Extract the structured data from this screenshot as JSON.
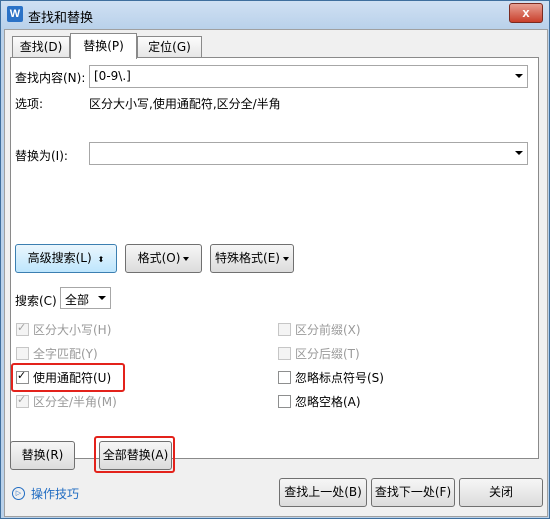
{
  "window": {
    "title": "查找和替换",
    "app_icon": "W",
    "close_glyph": "x"
  },
  "tabs": [
    {
      "label": "查找(D)",
      "active": false
    },
    {
      "label": "替换(P)",
      "active": true
    },
    {
      "label": "定位(G)",
      "active": false
    }
  ],
  "find": {
    "label": "查找内容(N):",
    "value": "[0-9\\.]"
  },
  "options": {
    "label": "选项:",
    "value": "区分大小写,使用通配符,区分全/半角"
  },
  "replace": {
    "label": "替换为(I):",
    "value": ""
  },
  "buttons": {
    "advanced": "高级搜索(L)",
    "advanced_glyph": "⬍",
    "format": "格式(O)",
    "special": "特殊格式(E)"
  },
  "search": {
    "label": "搜索(C)",
    "value": "全部"
  },
  "checkboxes": {
    "match_case": {
      "label": "区分大小写(H)",
      "checked": true,
      "enabled": false
    },
    "whole_word": {
      "label": "全字匹配(Y)",
      "checked": false,
      "enabled": false
    },
    "wildcards": {
      "label": "使用通配符(U)",
      "checked": true,
      "enabled": true
    },
    "width": {
      "label": "区分全/半角(M)",
      "checked": true,
      "enabled": false
    },
    "prefix": {
      "label": "区分前缀(X)",
      "checked": false,
      "enabled": false
    },
    "suffix": {
      "label": "区分后缀(T)",
      "checked": false,
      "enabled": false
    },
    "ignore_punct": {
      "label": "忽略标点符号(S)",
      "checked": false,
      "enabled": true
    },
    "ignore_space": {
      "label": "忽略空格(A)",
      "checked": false,
      "enabled": true
    }
  },
  "check_glyph": "✓",
  "actions": {
    "replace": "替换(R)",
    "replace_all": "全部替换(A)",
    "find_prev": "查找上一处(B)",
    "find_next": "查找下一处(F)",
    "close": "关闭"
  },
  "help": {
    "link": "操作技巧",
    "icon_glyph": "▷"
  },
  "colors": {
    "highlight": "#e3221b",
    "link": "#1f6bc2"
  }
}
